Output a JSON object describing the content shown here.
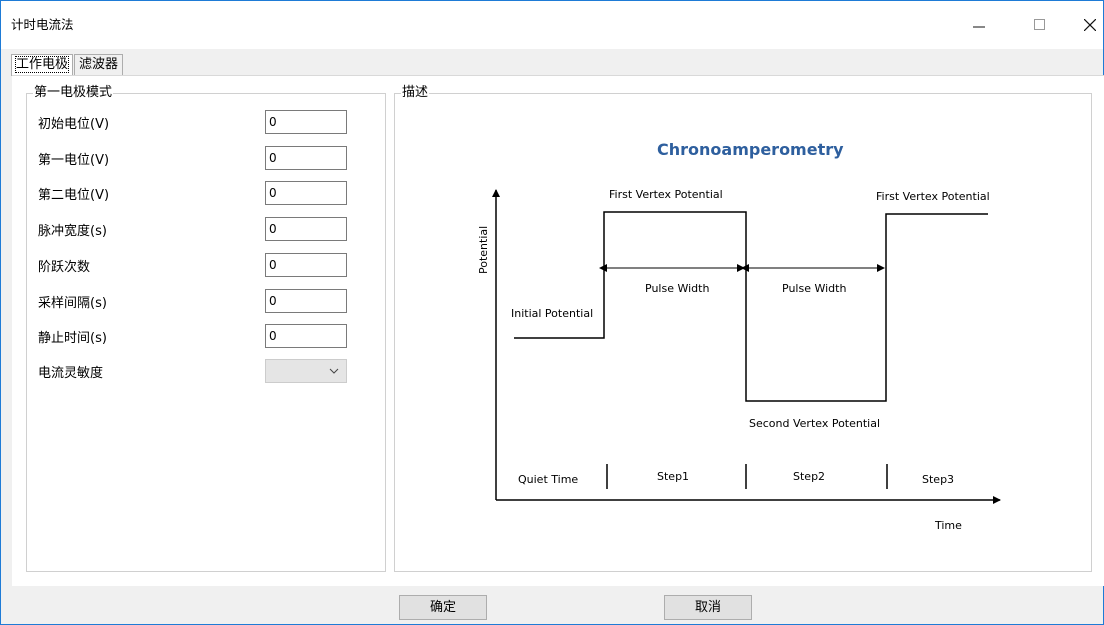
{
  "window": {
    "title": "计时电流法",
    "controls": {
      "minimize": "—",
      "maximize": "☐",
      "close": "✕"
    }
  },
  "tabs": [
    {
      "label": "工作电极",
      "active": true
    },
    {
      "label": "滤波器",
      "active": false
    }
  ],
  "mode_group": {
    "title": "第一电极模式",
    "fields": [
      {
        "label": "初始电位(V)",
        "value": "0"
      },
      {
        "label": "第一电位(V)",
        "value": "0"
      },
      {
        "label": "第二电位(V)",
        "value": "0"
      },
      {
        "label": "脉冲宽度(s)",
        "value": "0"
      },
      {
        "label": "阶跃次数",
        "value": "0"
      },
      {
        "label": "采样间隔(s)",
        "value": "0"
      },
      {
        "label": "静止时间(s)",
        "value": "0"
      }
    ],
    "sensitivity": {
      "label": "电流灵敏度",
      "value": ""
    }
  },
  "description_group": {
    "title": "描述",
    "diagram": {
      "title": "Chronoamperometry",
      "y_axis": "Potential",
      "x_axis": "Time",
      "labels": {
        "initial": "Initial Potential",
        "first_vertex_1": "First Vertex Potential",
        "first_vertex_2": "First Vertex Potential",
        "second_vertex": "Second Vertex Potential",
        "pulse_width_1": "Pulse Width",
        "pulse_width_2": "Pulse Width"
      },
      "phases": [
        "Quiet Time",
        "Step1",
        "Step2",
        "Step3"
      ],
      "title_color": "#2e5f9e"
    }
  },
  "footer": {
    "ok": "确定",
    "cancel": "取消"
  }
}
